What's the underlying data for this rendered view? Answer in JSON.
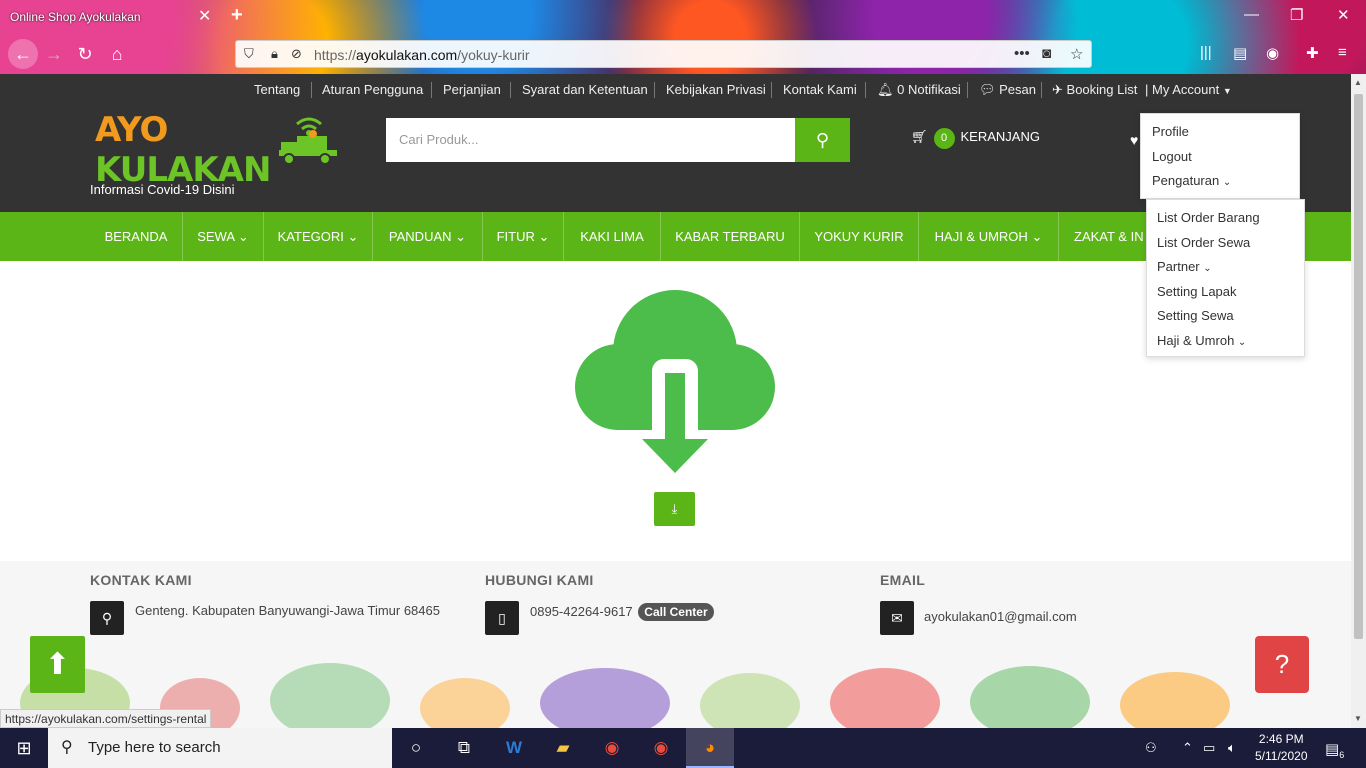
{
  "browser": {
    "tab_title": "Online Shop Ayokulakan",
    "url_prefix": "https://",
    "url_domain": "ayokulakan.com",
    "url_path": "/yokuy-kurir",
    "status_url": "https://ayokulakan.com/settings-rental"
  },
  "topnav": {
    "items": [
      "Tentang",
      "Aturan Pengguna",
      "Perjanjian",
      "Syarat dan Ketentuan",
      "Kebijakan Privasi",
      "Kontak Kami",
      "0 Notifikasi",
      "Pesan",
      "Booking List",
      "My Account"
    ]
  },
  "header": {
    "logo_ayo": "AYO",
    "logo_kulakan": "KULAKAN",
    "covid_link": "Informasi Covid-19 Disini",
    "search_placeholder": "Cari Produk...",
    "cart_count": "0",
    "cart_label": "KERANJANG"
  },
  "mainmenu": {
    "items": [
      "BERANDA",
      "SEWA",
      "KATEGORI",
      "PANDUAN",
      "FITUR",
      "KAKI LIMA",
      "KABAR TERBARU",
      "YOKUY KURIR",
      "HAJI & UMROH",
      "ZAKAT & IN"
    ]
  },
  "account_dropdown": {
    "items": [
      "Profile",
      "Logout",
      "Pengaturan"
    ]
  },
  "settings_dropdown": {
    "items": [
      "List Order Barang",
      "List Order Sewa",
      "Partner",
      "Setting Lapak",
      "Setting Sewa",
      "Haji & Umroh"
    ]
  },
  "footer": {
    "kontak_head": "KONTAK KAMI",
    "address": "Genteng. Kabupaten Banyuwangi-Jawa Timur 68465",
    "hubungi_head": "HUBUNGI KAMI",
    "phone": "0895-42264-9617",
    "call_center": "Call Center",
    "email_head": "EMAIL",
    "email": "ayokulakan01@gmail.com"
  },
  "taskbar": {
    "search_placeholder": "Type here to search",
    "time": "2:46 PM",
    "date": "5/11/2020",
    "notification_count": "6"
  },
  "colors": {
    "brand_green": "#5cb516",
    "header_dark": "#333333",
    "logo_orange": "#f29a1d",
    "help_red": "#e04444"
  }
}
